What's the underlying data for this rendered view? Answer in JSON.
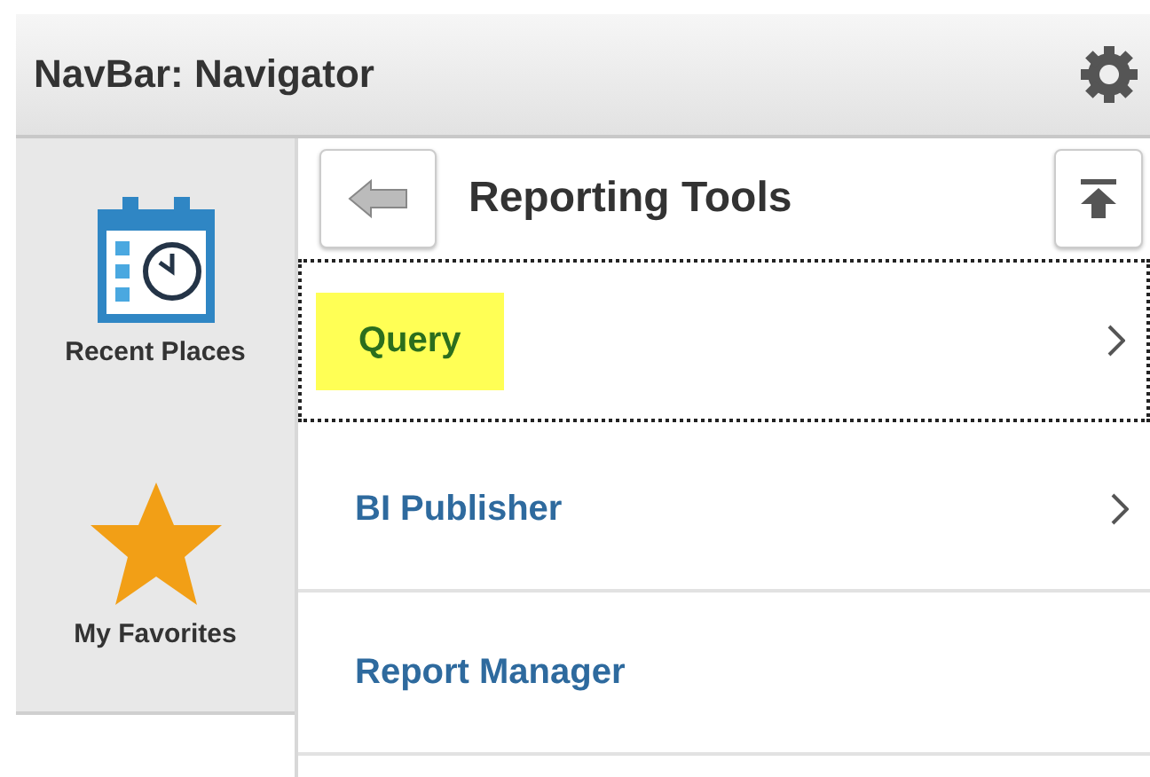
{
  "header": {
    "title": "NavBar: Navigator"
  },
  "sidebar": {
    "items": [
      {
        "label": "Recent Places",
        "kind": "recent"
      },
      {
        "label": "My Favorites",
        "kind": "favorites"
      }
    ]
  },
  "panel": {
    "title": "Reporting Tools"
  },
  "menu": {
    "items": [
      {
        "label": "Query",
        "selected": true,
        "highlighted": true,
        "has_submenu": true
      },
      {
        "label": "BI Publisher",
        "selected": false,
        "highlighted": false,
        "has_submenu": true
      },
      {
        "label": "Report Manager",
        "selected": false,
        "highlighted": false,
        "has_submenu": false
      }
    ]
  }
}
